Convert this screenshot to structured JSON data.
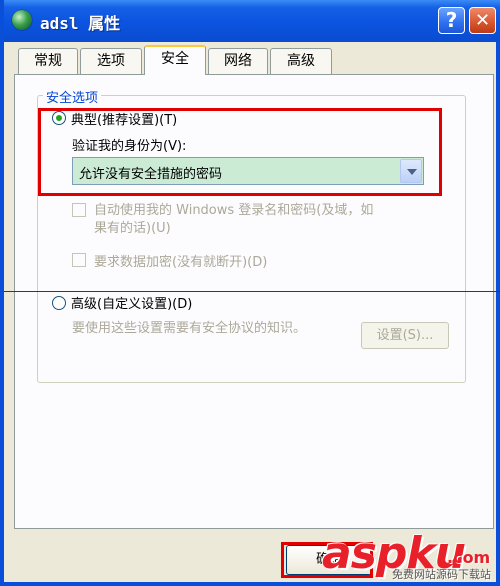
{
  "window": {
    "title": "adsl 属性"
  },
  "titlebar": {
    "help": "?",
    "close": "✕"
  },
  "tabs": [
    {
      "label": "常规"
    },
    {
      "label": "选项"
    },
    {
      "label": "安全"
    },
    {
      "label": "网络"
    },
    {
      "label": "高级"
    }
  ],
  "security": {
    "group_label": "安全选项",
    "typical_label": "典型(推荐设置)(T)",
    "verify_label": "验证我的身份为(V):",
    "verify_selected": "允许没有安全措施的密码",
    "auto_logon_line1": "自动使用我的 Windows 登录名和密码(及域，如",
    "auto_logon_line2": "果有的话)(U)",
    "require_encryption": "要求数据加密(没有就断开)(D)",
    "advanced_label": "高级(自定义设置)(D)",
    "advanced_desc": "要使用这些设置需要有安全协议的知识。",
    "settings_button": "设置(S)..."
  },
  "footer": {
    "ok_label": "确定"
  },
  "watermark": {
    "main": "aspku",
    "tld": ".com",
    "sub": "免费网站源码下载站"
  }
}
